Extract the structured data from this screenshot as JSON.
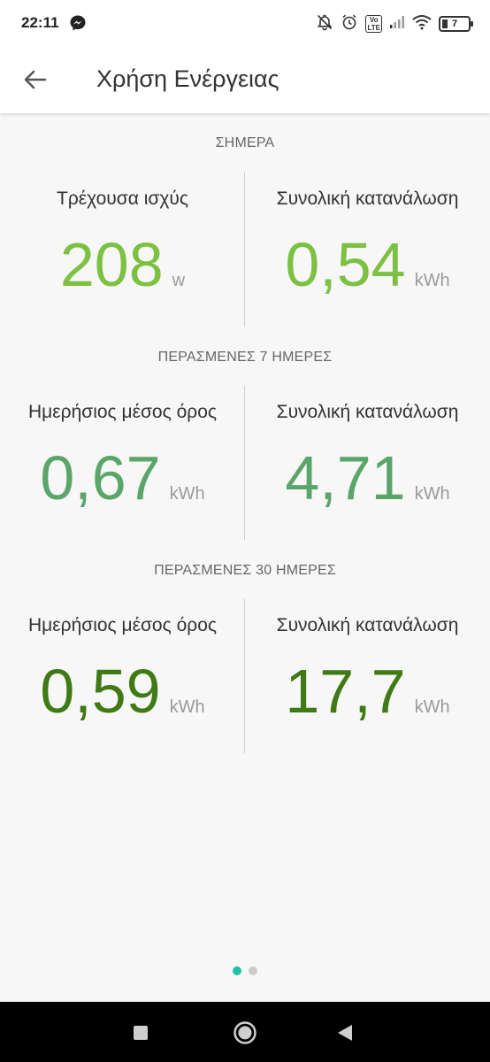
{
  "status_bar": {
    "time": "22:11",
    "battery_level": "7"
  },
  "app_bar": {
    "title": "Χρήση Ενέργειας"
  },
  "sections": [
    {
      "header": "ΣΗΜΕΡΑ",
      "color": "#7cc142",
      "left": {
        "label": "Τρέχουσα ισχύς",
        "value": "208",
        "unit": "w"
      },
      "right": {
        "label": "Συνολική κατανάλωση",
        "value": "0,54",
        "unit": "kWh"
      }
    },
    {
      "header": "ΠΕΡΑΣΜΕΝΕΣ 7 ΗΜΕΡΕΣ",
      "color": "#5aa66a",
      "left": {
        "label": "Ημερήσιος μέσος όρος",
        "value": "0,67",
        "unit": "kWh"
      },
      "right": {
        "label": "Συνολική κατανάλωση",
        "value": "4,71",
        "unit": "kWh"
      }
    },
    {
      "header": "ΠΕΡΑΣΜΕΝΕΣ 30 ΗΜΕΡΕΣ",
      "color": "#3f7a14",
      "left": {
        "label": "Ημερήσιος μέσος όρος",
        "value": "0,59",
        "unit": "kWh"
      },
      "right": {
        "label": "Συνολική κατανάλωση",
        "value": "17,7",
        "unit": "kWh"
      }
    }
  ],
  "pager": {
    "active_color": "#1fbfa8",
    "inactive_color": "#cccccc",
    "page_count": 2,
    "active_index": 0
  }
}
